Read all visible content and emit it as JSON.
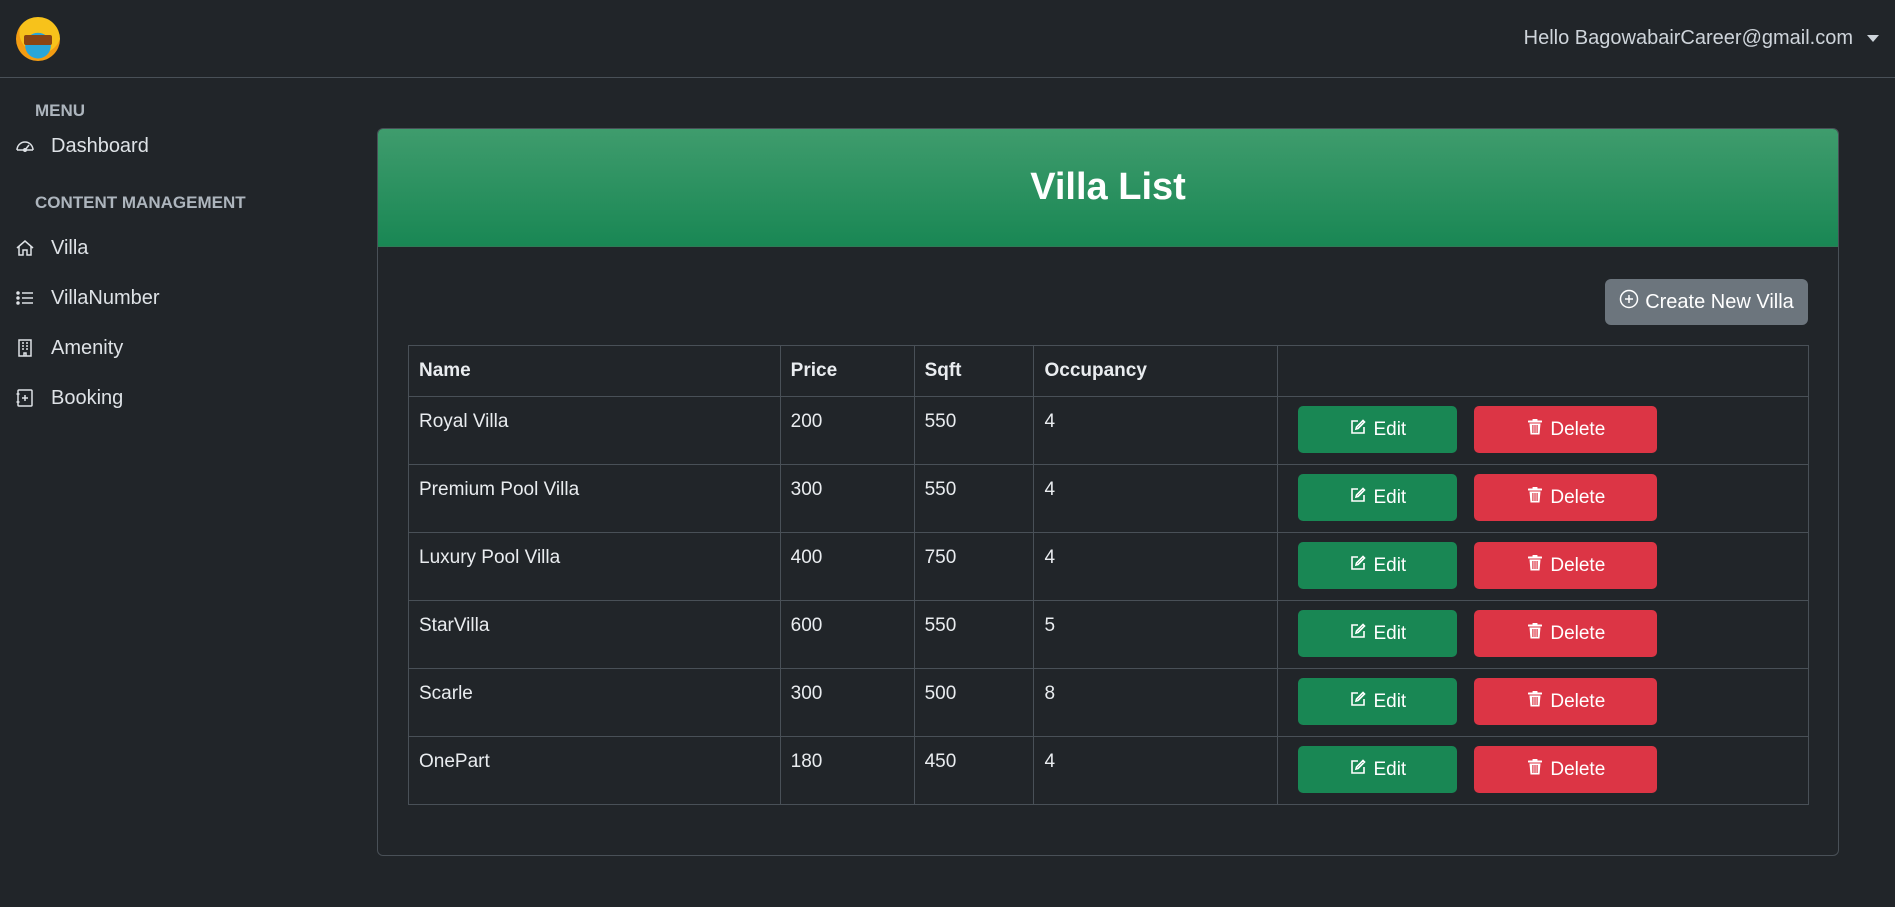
{
  "header": {
    "user_greeting": "Hello BagowabairCareer@gmail.com"
  },
  "sidebar": {
    "menu_title": "MENU",
    "dashboard_label": "Dashboard",
    "content_title": "CONTENT MANAGEMENT",
    "items": [
      {
        "label": "Villa",
        "icon": "house-icon"
      },
      {
        "label": "VillaNumber",
        "icon": "list-icon"
      },
      {
        "label": "Amenity",
        "icon": "building-icon"
      },
      {
        "label": "Booking",
        "icon": "calendar-plus-icon"
      }
    ]
  },
  "page": {
    "title": "Villa List",
    "create_button": "Create New Villa"
  },
  "table": {
    "columns": [
      "Name",
      "Price",
      "Sqft",
      "Occupancy",
      ""
    ],
    "rows": [
      {
        "name": "Royal Villa",
        "price": "200",
        "sqft": "550",
        "occupancy": "4"
      },
      {
        "name": "Premium Pool Villa",
        "price": "300",
        "sqft": "550",
        "occupancy": "4"
      },
      {
        "name": "Luxury Pool Villa",
        "price": "400",
        "sqft": "750",
        "occupancy": "4"
      },
      {
        "name": "StarVilla",
        "price": "600",
        "sqft": "550",
        "occupancy": "5"
      },
      {
        "name": "Scarle",
        "price": "300",
        "sqft": "500",
        "occupancy": "8"
      },
      {
        "name": "OnePart",
        "price": "180",
        "sqft": "450",
        "occupancy": "4"
      }
    ],
    "edit_label": "Edit",
    "delete_label": "Delete"
  },
  "colors": {
    "background": "#212529",
    "header_green": "#198754",
    "edit_green": "#198754",
    "delete_red": "#dc3545",
    "secondary_gray": "#6c757d"
  }
}
